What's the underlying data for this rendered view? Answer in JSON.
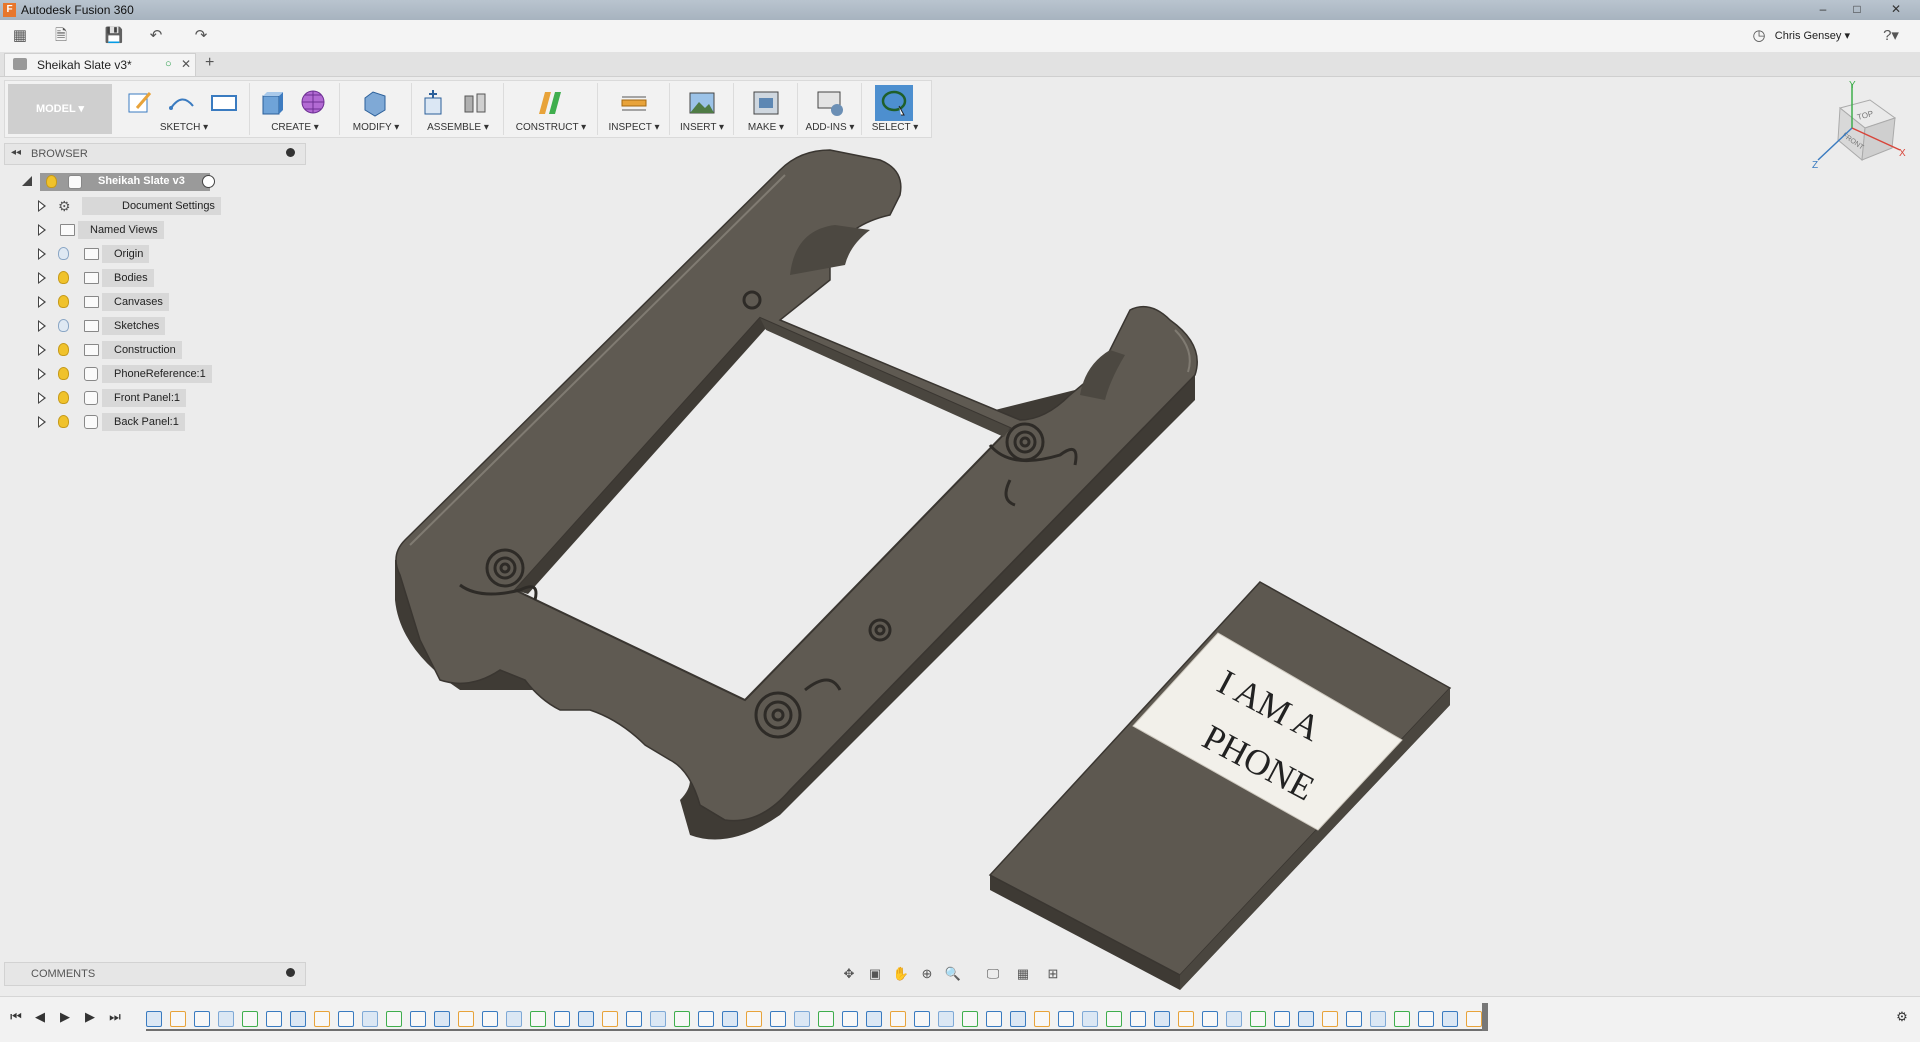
{
  "app": {
    "title": "Autodesk Fusion 360",
    "logo_letter": "F"
  },
  "window_controls": {
    "minimize": "–",
    "maximize": "□",
    "close": "✕"
  },
  "qat": {
    "user": "Chris Gensey ▾",
    "help": "?▾"
  },
  "document_tab": {
    "label": "Sheikah Slate v3*",
    "close": "✕",
    "new_tab": "+"
  },
  "toolbar": {
    "workspace": "MODEL ▾",
    "groups": [
      {
        "label": "SKETCH ▾"
      },
      {
        "label": "CREATE ▾"
      },
      {
        "label": "MODIFY ▾"
      },
      {
        "label": "ASSEMBLE ▾"
      },
      {
        "label": "CONSTRUCT ▾"
      },
      {
        "label": "INSPECT ▾"
      },
      {
        "label": "INSERT ▾"
      },
      {
        "label": "MAKE ▾"
      },
      {
        "label": "ADD-INS ▾"
      },
      {
        "label": "SELECT ▾"
      }
    ]
  },
  "browser": {
    "header": "BROWSER",
    "root": "Sheikah Slate v3",
    "items": [
      {
        "label": "Document Settings",
        "icon": "gear-icon"
      },
      {
        "label": "Named Views",
        "icon": "folder-icon"
      },
      {
        "label": "Origin",
        "icon": "folder-icon",
        "visible": false
      },
      {
        "label": "Bodies",
        "icon": "folder-icon",
        "visible": true
      },
      {
        "label": "Canvases",
        "icon": "folder-icon",
        "visible": true
      },
      {
        "label": "Sketches",
        "icon": "folder-icon",
        "visible": false
      },
      {
        "label": "Construction",
        "icon": "folder-icon",
        "visible": true
      },
      {
        "label": "PhoneReference:1",
        "icon": "component-icon",
        "visible": true
      },
      {
        "label": "Front Panel:1",
        "icon": "component-icon",
        "visible": true
      },
      {
        "label": "Back Panel:1",
        "icon": "component-icon",
        "visible": true
      }
    ]
  },
  "viewcube": {
    "top": "TOP",
    "front": "FRONT",
    "x": "X",
    "y": "Y",
    "z": "Z"
  },
  "canvas": {
    "line1": "I AM A",
    "line2": "PHONE"
  },
  "comments": {
    "header": "COMMENTS"
  },
  "colors": {
    "body": "#5f5a52",
    "body_light": "#74706a",
    "body_dark": "#45413b",
    "accent": "#0696d7"
  }
}
